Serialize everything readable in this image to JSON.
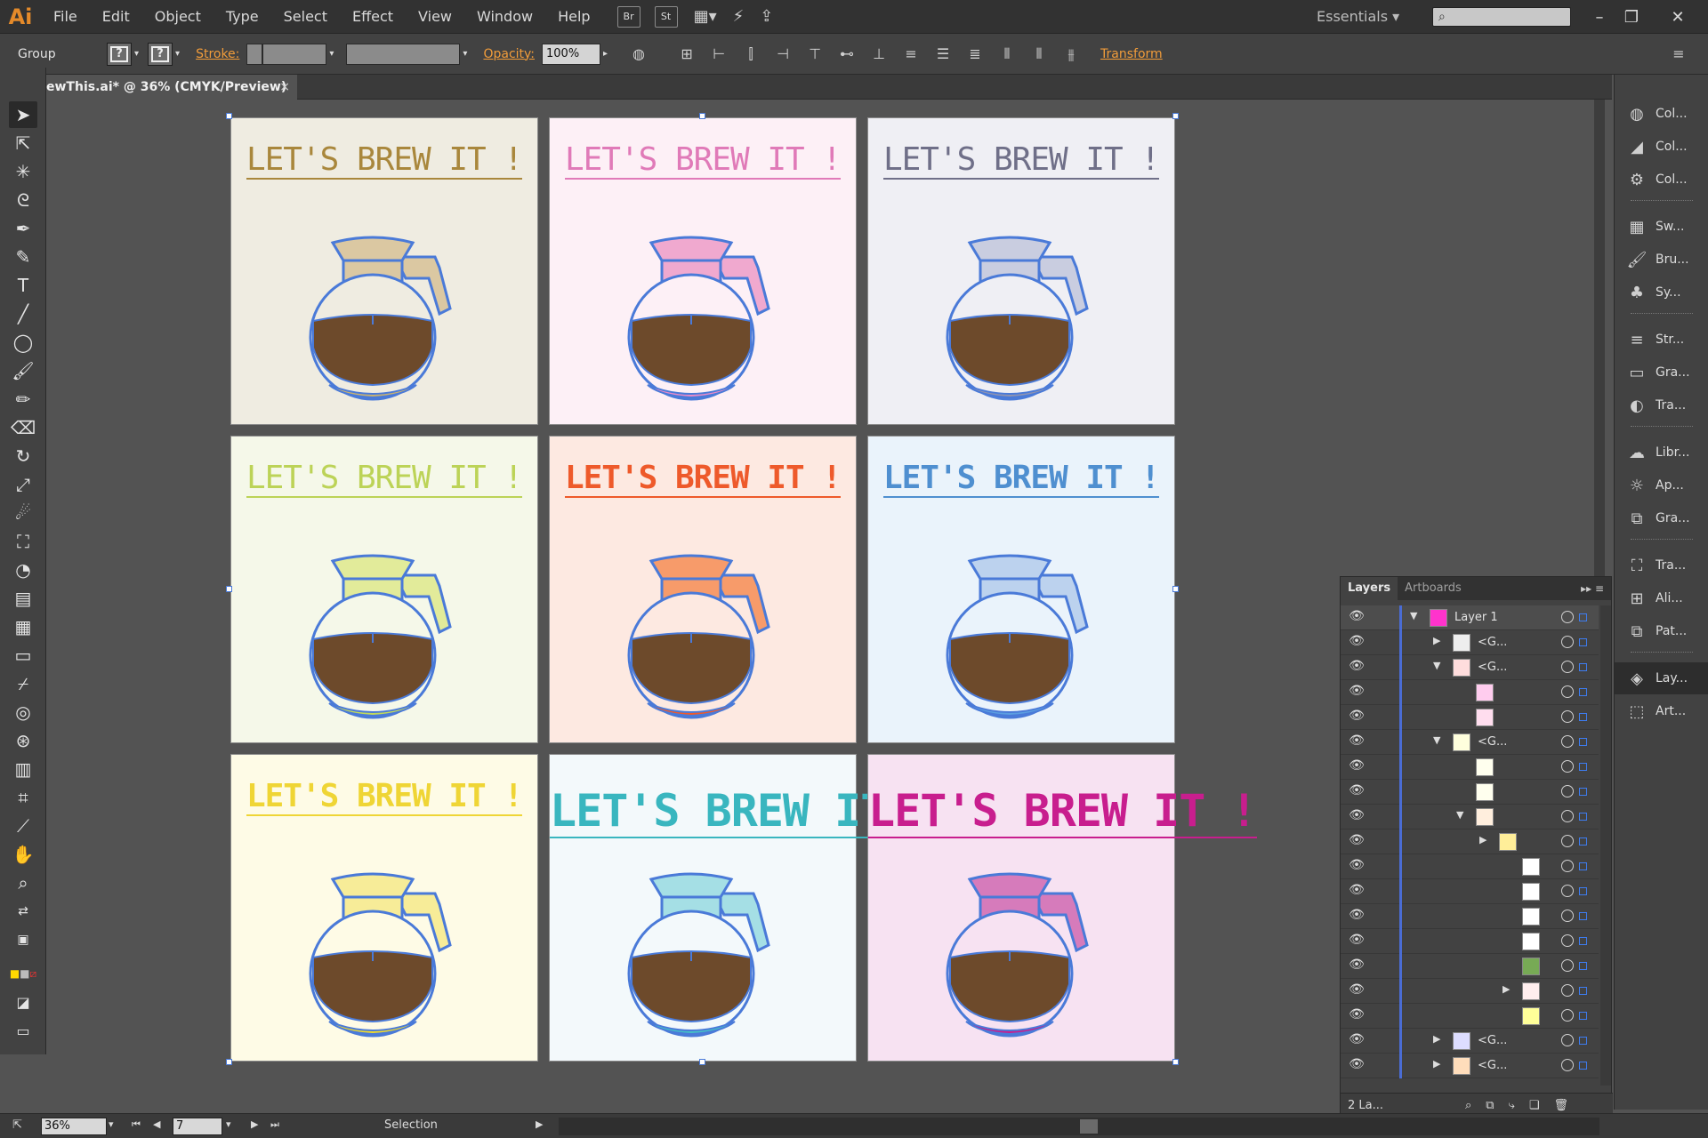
{
  "app": {
    "logo": "Ai",
    "workspace": "Essentials"
  },
  "menu": [
    "File",
    "Edit",
    "Object",
    "Type",
    "Select",
    "Effect",
    "View",
    "Window",
    "Help"
  ],
  "menubar_buttons": [
    "Br",
    "St"
  ],
  "control": {
    "selection_label": "Group",
    "stroke_label": "Stroke:",
    "opacity_label": "Opacity:",
    "opacity_value": "100%",
    "transform_label": "Transform",
    "unknown_glyph": "?"
  },
  "document": {
    "tab_title": "ewThis.ai* @ 36% (CMYK/Preview)",
    "tab_close": "×"
  },
  "artboards": [
    {
      "title": "LET'S BREW IT !",
      "bg": "#efece1",
      "text": "#a9873c",
      "lid": "#dbc8a2",
      "base": "#c8b171",
      "weight": "light"
    },
    {
      "title": "LET'S BREW IT !",
      "bg": "#fdf0f6",
      "text": "#e07ab8",
      "lid": "#f0a9cf",
      "base": "#e98ac7",
      "weight": "light"
    },
    {
      "title": "LET'S BREW IT !",
      "bg": "#efeff4",
      "text": "#6f6f88",
      "lid": "#c9cde0",
      "base": "#8f93b0",
      "weight": "light"
    },
    {
      "title": "LET'S BREW IT !",
      "bg": "#f5f8e9",
      "text": "#bcd357",
      "lid": "#e2eb9a",
      "base": "#c2d95a",
      "weight": "light"
    },
    {
      "title": "LET'S BREW IT !",
      "bg": "#fde9e1",
      "text": "#ee5a2b",
      "lid": "#f79b6a",
      "base": "#ee5a2b",
      "weight": "bold"
    },
    {
      "title": "LET'S BREW IT !",
      "bg": "#eaf3fb",
      "text": "#4f8fd0",
      "lid": "#bcd2ee",
      "base": "#5b9ee0",
      "weight": "bold"
    },
    {
      "title": "LET'S BREW IT !",
      "bg": "#fefbe6",
      "text": "#efd535",
      "lid": "#f7ec98",
      "base": "#f1db2b",
      "weight": "bold"
    },
    {
      "title": "LET'S BREW IT !",
      "bg": "#f3f9fb",
      "text": "#39b6bf",
      "lid": "#a5dfe5",
      "base": "#44c0c6",
      "weight": "bold"
    },
    {
      "title": "LET'S BREW IT !",
      "bg": "#f7e2f2",
      "text": "#c81e8e",
      "lid": "#d67bbb",
      "base": "#c81e8e",
      "weight": "bold"
    }
  ],
  "colors": {
    "coffee": "#6d4a2b",
    "selection": "#4a7ad8"
  },
  "dock": [
    "Col...",
    "Col...",
    "Col...",
    "Sw...",
    "Bru...",
    "Sy...",
    "Str...",
    "Gra...",
    "Tra...",
    "Libr...",
    "Ap...",
    "Gra...",
    "Tra...",
    "Ali...",
    "Pat...",
    "Lay...",
    "Art..."
  ],
  "layers_panel": {
    "tabs": [
      "Layers",
      "Artboards"
    ],
    "rows": [
      {
        "name": "Layer 1"
      },
      {
        "name": "<G..."
      },
      {
        "name": "<G..."
      },
      {
        "name": ""
      },
      {
        "name": ""
      },
      {
        "name": "<G..."
      },
      {
        "name": ""
      },
      {
        "name": ""
      },
      {
        "name": ""
      },
      {
        "name": ""
      },
      {
        "name": ""
      },
      {
        "name": ""
      },
      {
        "name": ""
      },
      {
        "name": ""
      },
      {
        "name": ""
      },
      {
        "name": ""
      },
      {
        "name": ""
      },
      {
        "name": "<G..."
      },
      {
        "name": "<G..."
      }
    ],
    "footer": "2 La..."
  },
  "status": {
    "zoom": "36%",
    "artboard_num": "7",
    "tool": "Selection"
  }
}
